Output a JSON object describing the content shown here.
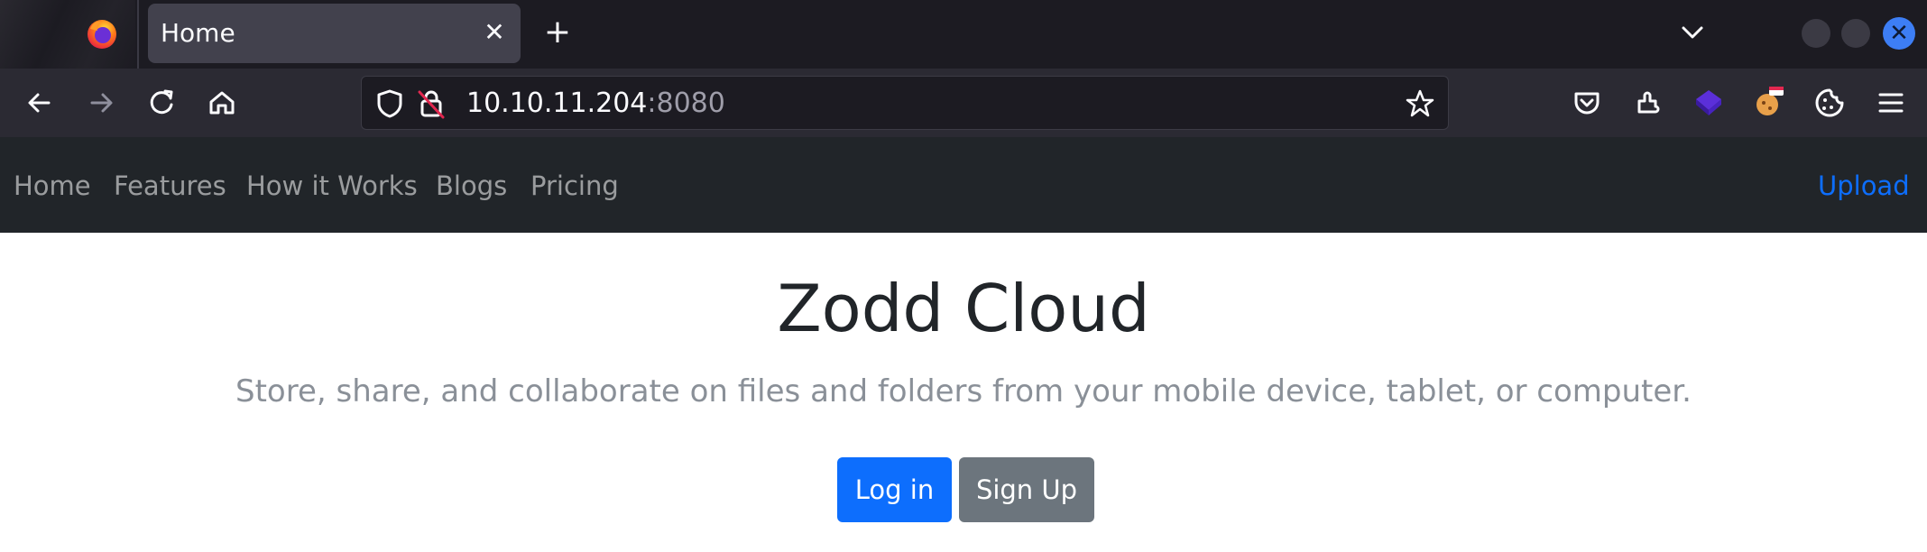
{
  "browser": {
    "tab_title": "Home",
    "close_glyph": "✕",
    "new_tab_glyph": "+",
    "url_host": "10.10.11.204",
    "url_port": ":8080",
    "icons": [
      "firefox-icon",
      "back-icon",
      "forward-icon",
      "reload-icon",
      "home-icon",
      "shield-icon",
      "insecure-lock-icon",
      "bookmark-star-icon",
      "pocket-icon",
      "extensions-icon",
      "extension-cube-icon",
      "extension-cookie-editor-icon",
      "extension-cookie-icon",
      "menu-icon"
    ]
  },
  "site_nav": {
    "links": [
      "Home",
      "Features",
      "How it Works",
      "Blogs",
      "Pricing"
    ],
    "upload": "Upload"
  },
  "hero": {
    "title": "Zodd Cloud",
    "subtitle": "Store, share, and collaborate on files and folders from your mobile device, tablet, or computer.",
    "login": "Log in",
    "signup": "Sign Up"
  },
  "colors": {
    "accent": "#0d6efd",
    "secondary": "#6c757d",
    "site_nav_bg": "#212529",
    "browser_bg": "#1c1b22"
  }
}
